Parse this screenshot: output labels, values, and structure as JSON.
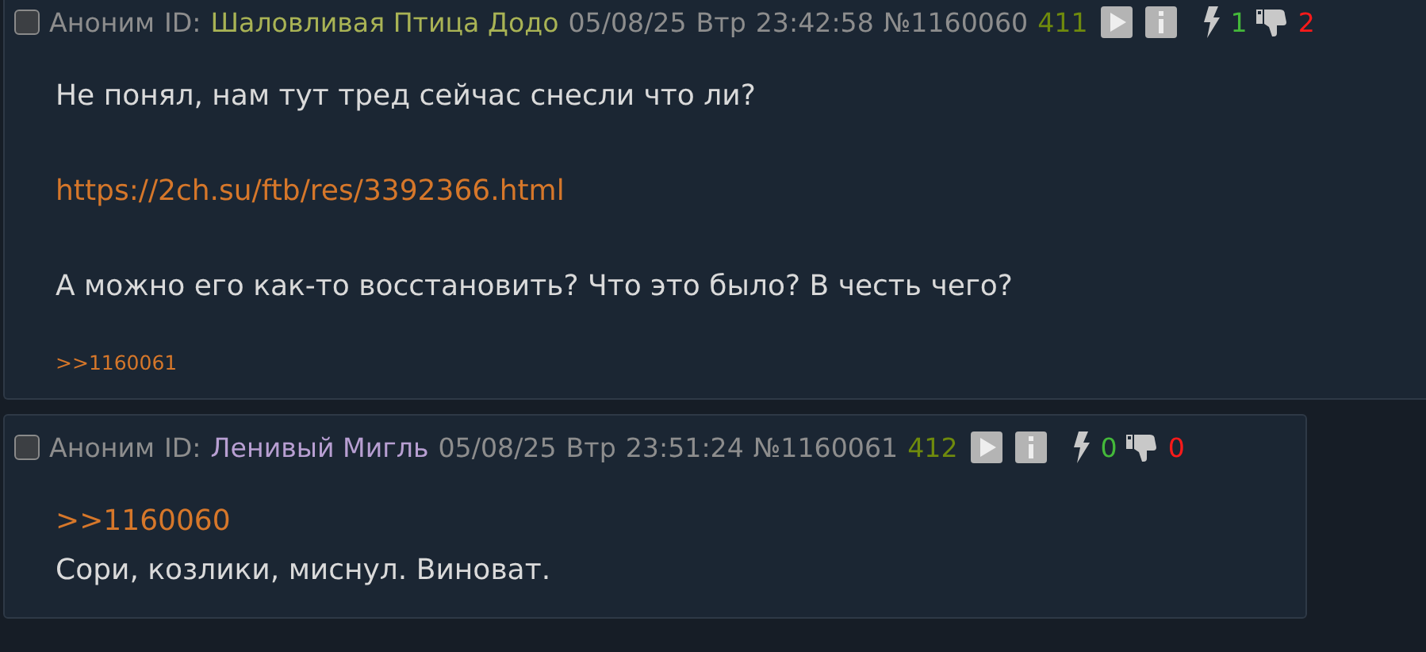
{
  "posts": [
    {
      "checked": false,
      "author": "Аноним",
      "id_label": "ID:",
      "id_name": "Шаловливая Птица Додо",
      "color": "#a9b355",
      "date": "05/08/25",
      "weekday": "Втр",
      "time": "23:42:58",
      "number": "№1160060",
      "index": "411",
      "likes": "1",
      "dislikes": "2",
      "paragraphs": [
        [
          {
            "kind": "text",
            "text": "Не понял, нам тут тред сейчас снесли что ли?"
          }
        ],
        [
          {
            "kind": "link",
            "text": "https://2ch.su/ftb/res/3392366.html"
          }
        ],
        [
          {
            "kind": "text",
            "text": "А можно его как-то восстановить? Что это было? В честь чего?"
          }
        ]
      ],
      "replies": [
        ">>1160061"
      ]
    },
    {
      "checked": false,
      "author": "Аноним",
      "id_label": "ID:",
      "id_name": "Ленивый Мигль",
      "color": "#b89fd2",
      "date": "05/08/25",
      "weekday": "Втр",
      "time": "23:51:24",
      "number": "№1160061",
      "index": "412",
      "likes": "0",
      "dislikes": "0",
      "paragraphs": [
        [
          {
            "kind": "link",
            "text": ">>1160060"
          },
          {
            "kind": "text",
            "text": "Сори, козлики, миснул. Виноват."
          }
        ]
      ]
    }
  ]
}
